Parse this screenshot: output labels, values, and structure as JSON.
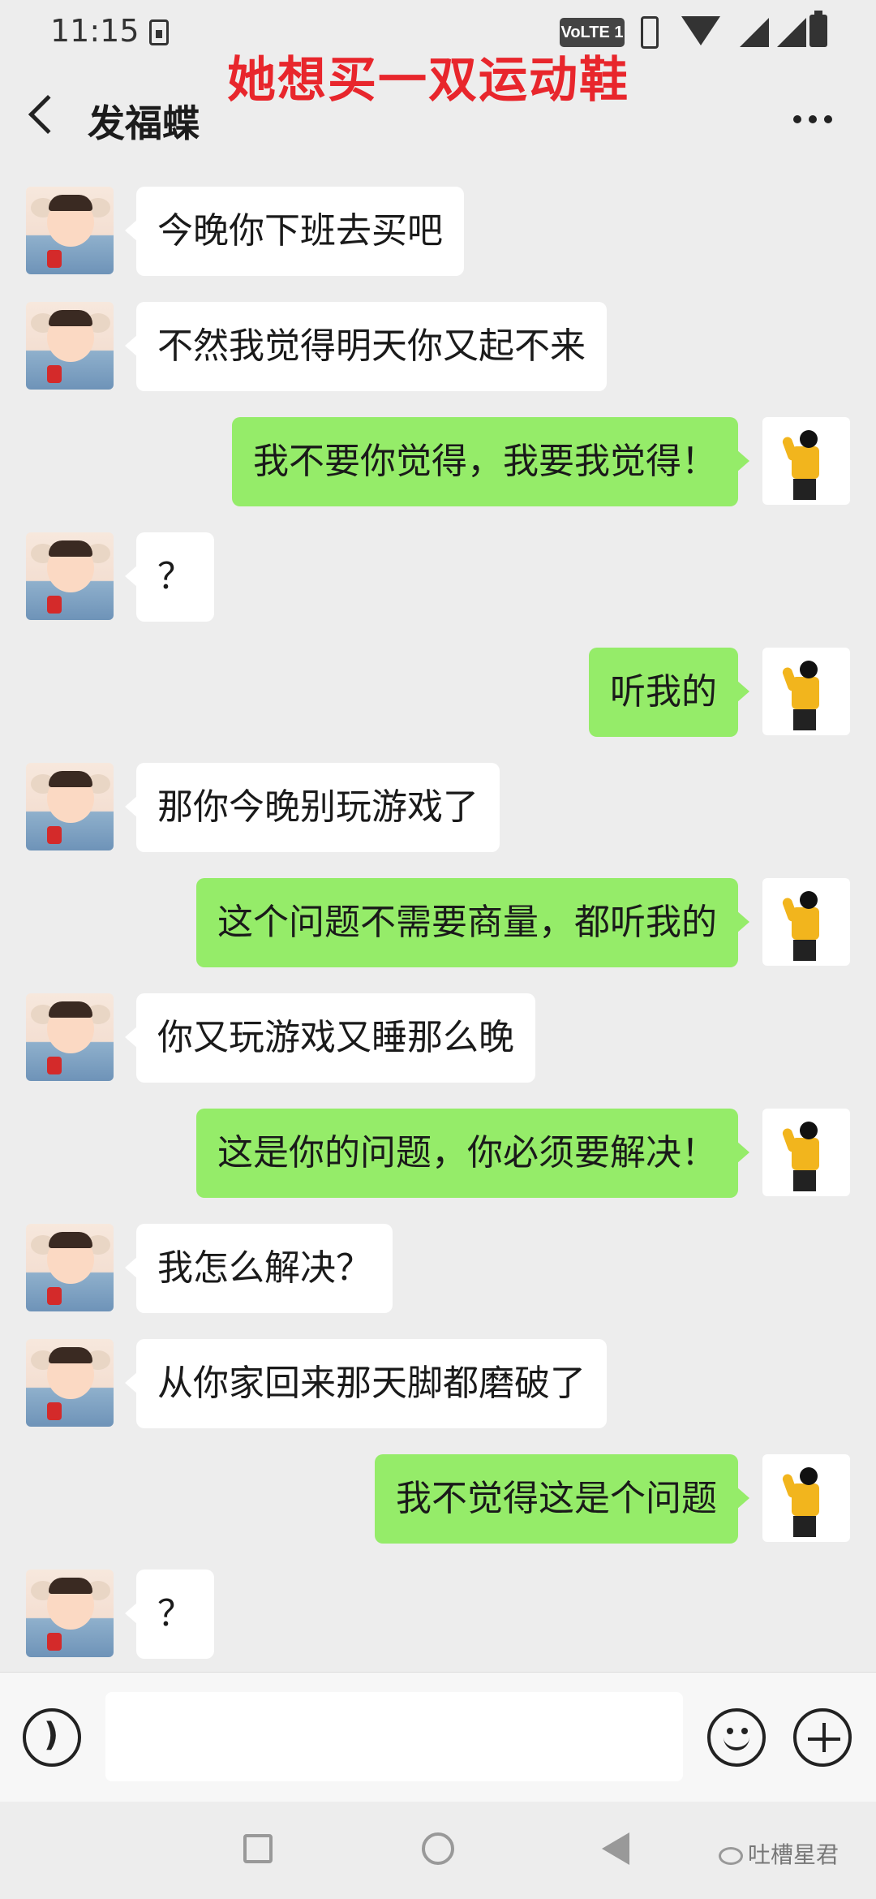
{
  "status_bar": {
    "time": "11:15",
    "network_badge": "VoLTE 1"
  },
  "overlay_caption": "她想买一双运动鞋",
  "header": {
    "title": "发福蝶"
  },
  "messages": [
    {
      "side": "left",
      "text": "今晚你下班去买吧"
    },
    {
      "side": "left",
      "text": "不然我觉得明天你又起不来"
    },
    {
      "side": "right",
      "text": "我不要你觉得，我要我觉得！"
    },
    {
      "side": "left",
      "text": "？"
    },
    {
      "side": "right",
      "text": "听我的"
    },
    {
      "side": "left",
      "text": "那你今晚别玩游戏了"
    },
    {
      "side": "right",
      "text": "这个问题不需要商量，都听我的"
    },
    {
      "side": "left",
      "text": "你又玩游戏又睡那么晚"
    },
    {
      "side": "right",
      "text": "这是你的问题，你必须要解决！"
    },
    {
      "side": "left",
      "text": "我怎么解决？"
    },
    {
      "side": "left",
      "text": "从你家回来那天脚都磨破了"
    },
    {
      "side": "right",
      "text": "我不觉得这是个问题"
    },
    {
      "side": "left",
      "text": "？"
    }
  ],
  "input": {
    "value": ""
  },
  "watermark": "吐槽星君"
}
